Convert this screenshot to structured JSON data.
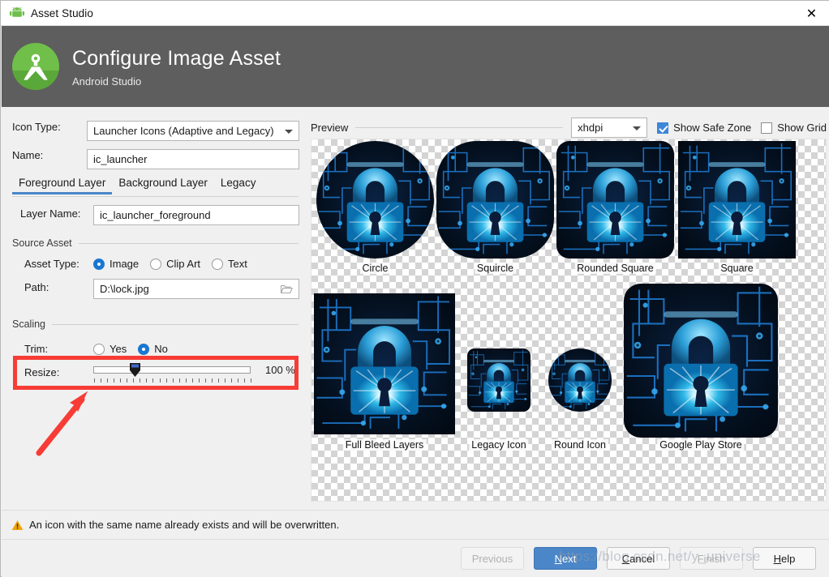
{
  "window": {
    "title": "Asset Studio",
    "icon": "android-robot-icon",
    "close_label": "✕"
  },
  "header": {
    "title": "Configure Image Asset",
    "subtitle": "Android Studio",
    "logo": "android-studio-logo"
  },
  "form": {
    "icon_type_label": "Icon Type:",
    "icon_type_value": "Launcher Icons (Adaptive and Legacy)",
    "name_label": "Name:",
    "name_value": "ic_launcher",
    "tabs": [
      {
        "label": "Foreground Layer",
        "active": true
      },
      {
        "label": "Background Layer",
        "active": false
      },
      {
        "label": "Legacy",
        "active": false
      }
    ],
    "layer_name_label": "Layer Name:",
    "layer_name_value": "ic_launcher_foreground",
    "source_asset_group": "Source Asset",
    "asset_type_label": "Asset Type:",
    "asset_type_options": [
      {
        "label": "Image",
        "selected": true
      },
      {
        "label": "Clip Art",
        "selected": false
      },
      {
        "label": "Text",
        "selected": false
      }
    ],
    "path_label": "Path:",
    "path_value": "D:\\lock.jpg",
    "path_browse_icon": "folder-icon",
    "scaling_group": "Scaling",
    "trim_label": "Trim:",
    "trim_options": [
      {
        "label": "Yes",
        "selected": false
      },
      {
        "label": "No",
        "selected": true
      }
    ],
    "resize_label": "Resize:",
    "resize_value": "100 %",
    "resize_percent": 100
  },
  "preview": {
    "title": "Preview",
    "density_value": "xhdpi",
    "show_safe_zone": {
      "label": "Show Safe Zone",
      "checked": true
    },
    "show_grid": {
      "label": "Show Grid",
      "checked": false
    },
    "thumbnails": [
      {
        "caption": "Circle",
        "shape": "circle"
      },
      {
        "caption": "Squircle",
        "shape": "squircle"
      },
      {
        "caption": "Rounded Square",
        "shape": "rounded-square"
      },
      {
        "caption": "Square",
        "shape": "square"
      },
      {
        "caption": "Full Bleed Layers",
        "shape": "square"
      },
      {
        "caption": "Legacy Icon",
        "shape": "rounded-square"
      },
      {
        "caption": "Round Icon",
        "shape": "circle"
      },
      {
        "caption": "Google Play Store",
        "shape": "rounded-square"
      }
    ]
  },
  "footer": {
    "warning_icon": "warning-triangle-icon",
    "warning_text": "An icon with the same name already exists and will be overwritten.",
    "buttons": [
      {
        "name": "previous",
        "label": "Previous",
        "state": "disabled"
      },
      {
        "name": "next",
        "label": "Next",
        "state": "primary",
        "mnemonic": "N"
      },
      {
        "name": "cancel",
        "label": "Cancel",
        "state": "normal",
        "mnemonic": "C"
      },
      {
        "name": "finish",
        "label": "Finish",
        "state": "disabled"
      },
      {
        "name": "help",
        "label": "Help",
        "state": "normal",
        "mnemonic": "H"
      }
    ]
  },
  "annotations": {
    "highlight_color": "#f73c36",
    "arrow_color": "#f73c36",
    "watermark": "https://blog.csdn.net/y_universe"
  }
}
